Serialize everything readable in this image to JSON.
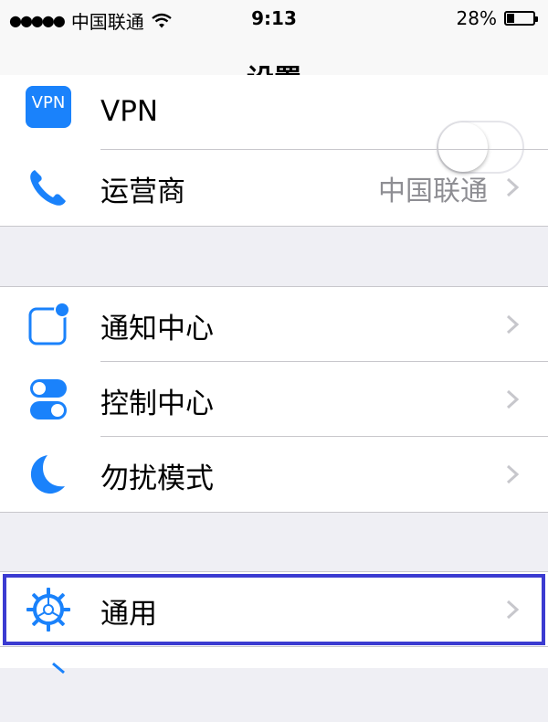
{
  "status_bar": {
    "signal": "●●●●●",
    "carrier": "中国联通",
    "time": "9:13",
    "battery": "28%",
    "battery_level": 0.28
  },
  "nav": {
    "title": "设置"
  },
  "rows": {
    "vpn": {
      "label": "VPN",
      "icon_text": "VPN",
      "toggle_on": false
    },
    "carrier": {
      "label": "运营商",
      "value": "中国联通"
    },
    "notifications": {
      "label": "通知中心"
    },
    "control_center": {
      "label": "控制中心"
    },
    "do_not_disturb": {
      "label": "勿扰模式"
    },
    "general": {
      "label": "通用"
    }
  },
  "icons": {
    "vpn": "vpn-icon",
    "carrier": "phone-icon",
    "notifications": "notification-icon",
    "control_center": "toggle-switches-icon",
    "do_not_disturb": "moon-icon",
    "general": "gear-icon",
    "chevron": "chevron-right-icon",
    "wifi": "wifi-icon",
    "battery": "battery-icon"
  },
  "colors": {
    "accent": "#1a82fb",
    "highlight": "#3b3bd1",
    "secondary_text": "#8e8e93",
    "background": "#efeff4"
  }
}
